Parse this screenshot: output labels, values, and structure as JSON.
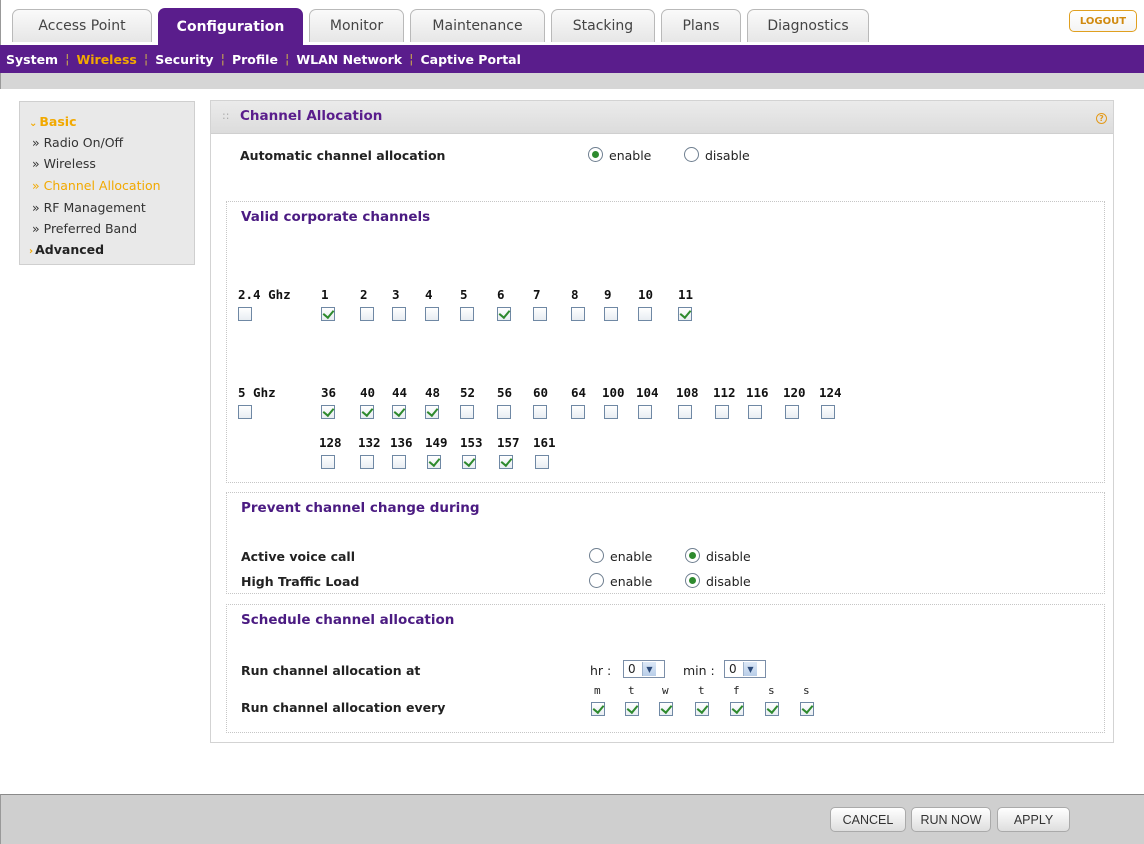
{
  "tabs": [
    "Access Point",
    "Configuration",
    "Monitor",
    "Maintenance",
    "Stacking",
    "Plans",
    "Diagnostics"
  ],
  "active_tab": "Configuration",
  "logout_label": "LOGOUT",
  "subnav": [
    "System",
    "Wireless",
    "Security",
    "Profile",
    "WLAN Network",
    "Captive Portal"
  ],
  "active_subnav": "Wireless",
  "left_menu": {
    "basic": "Basic",
    "items": [
      "Radio On/Off",
      "Wireless",
      "Channel Allocation",
      "RF Management",
      "Preferred Band"
    ],
    "active_item": "Channel Allocation",
    "advanced": "Advanced"
  },
  "panel": {
    "title": "Channel Allocation",
    "auto_label": "Automatic channel allocation",
    "auto_value": "enable",
    "enable_label": "enable",
    "disable_label": "disable",
    "valid_title": "Valid corporate channels",
    "band24_label": "2.4 Ghz",
    "band24_all_checked": false,
    "band24_channels": [
      {
        "ch": "1",
        "checked": true
      },
      {
        "ch": "2",
        "checked": false
      },
      {
        "ch": "3",
        "checked": false
      },
      {
        "ch": "4",
        "checked": false
      },
      {
        "ch": "5",
        "checked": false
      },
      {
        "ch": "6",
        "checked": true
      },
      {
        "ch": "7",
        "checked": false
      },
      {
        "ch": "8",
        "checked": false
      },
      {
        "ch": "9",
        "checked": false
      },
      {
        "ch": "10",
        "checked": false
      },
      {
        "ch": "11",
        "checked": true
      }
    ],
    "band5_label": "5 Ghz",
    "band5_all_checked": false,
    "band5_row1": [
      {
        "ch": "36",
        "checked": true
      },
      {
        "ch": "40",
        "checked": true
      },
      {
        "ch": "44",
        "checked": true
      },
      {
        "ch": "48",
        "checked": true
      },
      {
        "ch": "52",
        "checked": false
      },
      {
        "ch": "56",
        "checked": false
      },
      {
        "ch": "60",
        "checked": false
      },
      {
        "ch": "64",
        "checked": false
      },
      {
        "ch": "100",
        "checked": false
      },
      {
        "ch": "104",
        "checked": false
      },
      {
        "ch": "108",
        "checked": false
      },
      {
        "ch": "112",
        "checked": false
      },
      {
        "ch": "116",
        "checked": false
      },
      {
        "ch": "120",
        "checked": false
      },
      {
        "ch": "124",
        "checked": false
      }
    ],
    "band5_row2": [
      {
        "ch": "128",
        "checked": false
      },
      {
        "ch": "132",
        "checked": false
      },
      {
        "ch": "136",
        "checked": false
      },
      {
        "ch": "149",
        "checked": true
      },
      {
        "ch": "153",
        "checked": true
      },
      {
        "ch": "157",
        "checked": true
      },
      {
        "ch": "161",
        "checked": false
      }
    ],
    "prevent_title": "Prevent channel change during",
    "voice_label": "Active voice call",
    "voice_value": "disable",
    "traffic_label": "High Traffic Load",
    "traffic_value": "disable",
    "schedule_title": "Schedule channel allocation",
    "run_at_label": "Run channel allocation at",
    "hr_label": "hr :",
    "hr_value": "0",
    "min_label": "min :",
    "min_value": "0",
    "run_every_label": "Run channel allocation every",
    "days": [
      {
        "d": "m",
        "checked": true
      },
      {
        "d": "t",
        "checked": true
      },
      {
        "d": "w",
        "checked": true
      },
      {
        "d": "t",
        "checked": true
      },
      {
        "d": "f",
        "checked": true
      },
      {
        "d": "s",
        "checked": true
      },
      {
        "d": "s",
        "checked": true
      }
    ]
  },
  "buttons": {
    "cancel": "CANCEL",
    "run_now": "RUN NOW",
    "apply": "APPLY"
  },
  "colors": {
    "brand_purple": "#5a1d8c",
    "accent_orange": "#f2a900",
    "check_green": "#2e8a2e"
  }
}
